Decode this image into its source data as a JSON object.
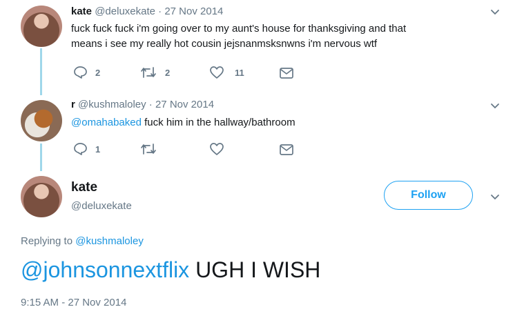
{
  "tweet1": {
    "name": "kate",
    "handle": "@deluxekate",
    "sep": "·",
    "date": "27 Nov 2014",
    "text_line1": "fuck fuck fuck i'm going over to my aunt's house for thanksgiving and that",
    "text_line2": "means i see my really hot cousin jejsnanmsksnwns i'm nervous wtf",
    "replies": "2",
    "retweets": "2",
    "likes": "11"
  },
  "tweet2": {
    "name": "r",
    "handle": "@kushmaloley",
    "sep": "·",
    "date": "27 Nov 2014",
    "mention": "@omahabaked",
    "text": " fuck him in the hallway/bathroom",
    "replies": "1",
    "retweets": "",
    "likes": ""
  },
  "main": {
    "name": "kate",
    "handle": "@deluxekate",
    "follow_label": "Follow",
    "replying_prefix": "Replying to ",
    "replying_to": "@kushmaloley",
    "mention": "@johnsonnextflix",
    "text": " UGH I WISH",
    "timestamp": "9:15 AM - 27 Nov 2014"
  },
  "colors": {
    "link": "#1b95e0",
    "follow": "#1da1f2",
    "muted": "#657786",
    "thread_line": "#9fd7ea"
  },
  "icons": [
    "reply-icon",
    "retweet-icon",
    "like-icon",
    "message-icon",
    "chevron-down-icon"
  ]
}
